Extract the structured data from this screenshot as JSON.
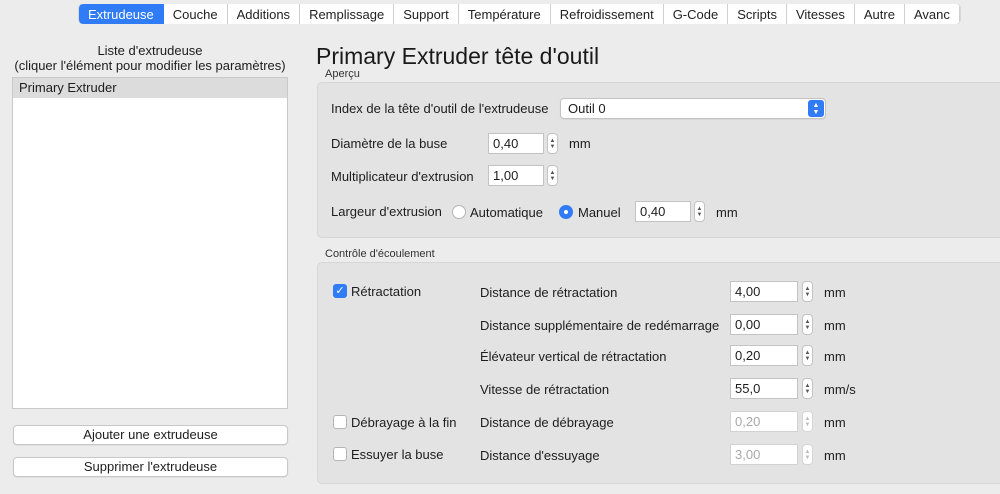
{
  "tabs": [
    {
      "label": "Extrudeuse",
      "active": true
    },
    {
      "label": "Couche"
    },
    {
      "label": "Additions"
    },
    {
      "label": "Remplissage"
    },
    {
      "label": "Support"
    },
    {
      "label": "Température"
    },
    {
      "label": "Refroidissement"
    },
    {
      "label": "G-Code"
    },
    {
      "label": "Scripts"
    },
    {
      "label": "Vitesses"
    },
    {
      "label": "Autre"
    },
    {
      "label": "Avanc"
    }
  ],
  "left": {
    "title_line1": "Liste d'extrudeuse",
    "title_line2": "(cliquer l'élément pour modifier les paramètres)",
    "extruders": [
      "Primary Extruder"
    ],
    "add_button": "Ajouter une extrudeuse",
    "remove_button": "Supprimer l'extrudeuse"
  },
  "main": {
    "title": "Primary Extruder tête d'outil",
    "overview": {
      "group_label": "Aperçu",
      "tool_index_label": "Index de la tête d'outil de l'extrudeuse",
      "tool_index_value": "Outil 0",
      "nozzle_label": "Diamètre de la buse",
      "nozzle_value": "0,40",
      "nozzle_unit": "mm",
      "multiplier_label": "Multiplicateur d'extrusion",
      "multiplier_value": "1,00",
      "width_label": "Largeur d'extrusion",
      "width_auto_label": "Automatique",
      "width_manual_label": "Manuel",
      "width_value": "0,40",
      "width_unit": "mm"
    },
    "flow": {
      "group_label": "Contrôle d'écoulement",
      "retraction_label": "Rétractation",
      "retraction_checked": true,
      "retraction_distance_label": "Distance de rétractation",
      "retraction_distance_value": "4,00",
      "retraction_distance_unit": "mm",
      "extra_restart_label": "Distance supplémentaire de redémarrage",
      "extra_restart_value": "0,00",
      "extra_restart_unit": "mm",
      "lift_label": "Élévateur vertical de rétractation",
      "lift_value": "0,20",
      "lift_unit": "mm",
      "speed_label": "Vitesse de rétractation",
      "speed_value": "55,0",
      "speed_unit": "mm/s",
      "coast_label": "Débrayage à la fin",
      "coast_checked": false,
      "coast_distance_label": "Distance de débrayage",
      "coast_distance_value": "0,20",
      "coast_distance_unit": "mm",
      "wipe_label": "Essuyer la buse",
      "wipe_checked": false,
      "wipe_distance_label": "Distance d'essuyage",
      "wipe_distance_value": "3,00",
      "wipe_distance_unit": "mm"
    }
  },
  "colors": {
    "accent": "#2f7cf6",
    "background": "#ececec"
  }
}
